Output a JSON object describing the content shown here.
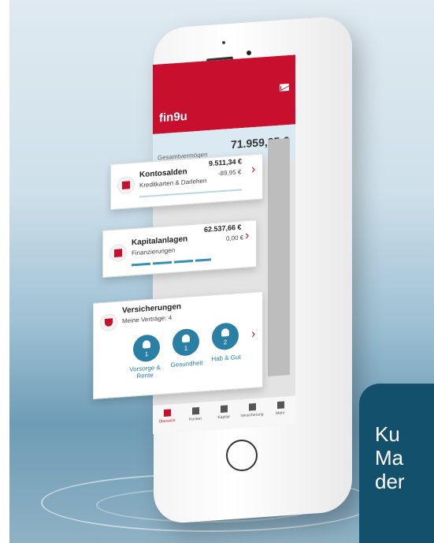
{
  "app": {
    "logo": "fin9u",
    "total_label": "Gesamtvermögen",
    "total_value": "71.959,05 €"
  },
  "cards": {
    "kontosalden": {
      "title": "Kontosalden",
      "subtitle": "Kreditkarten & Darlehen",
      "value": "9.511,34 €",
      "value2": "-89,95 €"
    },
    "kapital": {
      "title": "Kapitalanlagen",
      "subtitle": "Finanzierungen",
      "value": "62.537,66 €",
      "value2": "0,00 €"
    },
    "versicherungen": {
      "title": "Versicherungen",
      "subtitle": "Meine Verträge: 4",
      "items": [
        {
          "label": "Vorsorge & Rente",
          "count": "1"
        },
        {
          "label": "Gesundheit",
          "count": "1"
        },
        {
          "label": "Hab & Gut",
          "count": "2"
        }
      ]
    }
  },
  "tabs": [
    {
      "label": "Übersicht"
    },
    {
      "label": "Konten"
    },
    {
      "label": "Kapital"
    },
    {
      "label": "Versicherung"
    },
    {
      "label": "Mehr"
    }
  ],
  "promo": {
    "line1": "Ku",
    "line2": "Ma",
    "line3": "der"
  },
  "colors": {
    "brand_red": "#c8102e",
    "accent_blue": "#2a7fa5",
    "promo_bg": "#13506c"
  }
}
